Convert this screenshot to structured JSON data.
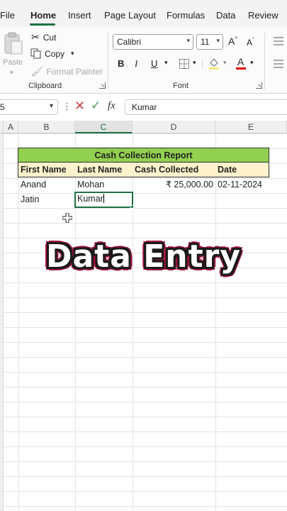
{
  "ribbon_tabs": [
    "File",
    "Home",
    "Insert",
    "Page Layout",
    "Formulas",
    "Data",
    "Review"
  ],
  "clipboard": {
    "paste_label": "Paste",
    "cut_label": "Cut",
    "copy_label": "Copy",
    "format_painter_label": "Format Painter",
    "group_label": "Clipboard"
  },
  "font": {
    "font_name": "Calibri",
    "font_size": "11",
    "bold_label": "B",
    "italic_label": "I",
    "underline_label": "U",
    "grow_label": "A",
    "shrink_label": "A",
    "font_color_label": "A",
    "group_label": "Font"
  },
  "formula_bar": {
    "name_box": "5",
    "fx_label": "fx",
    "value": "Kumar"
  },
  "columns": [
    "A",
    "B",
    "C",
    "D",
    "E"
  ],
  "sheet": {
    "title": "Cash Collection Report",
    "headers": [
      "First Name",
      "Last Name",
      "Cash Collected",
      "Date"
    ],
    "rows": [
      [
        "Anand",
        "Mohan",
        "₹ 25,000.00",
        "02-11-2024"
      ],
      [
        "Jatin",
        "Kumar",
        "",
        ""
      ]
    ]
  },
  "overlay_text": "Data Entry",
  "colors": {
    "accent": "#1e7145",
    "title_fill": "#92d050",
    "header_fill": "#fff2cc",
    "font_color_bar": "#e00000"
  }
}
